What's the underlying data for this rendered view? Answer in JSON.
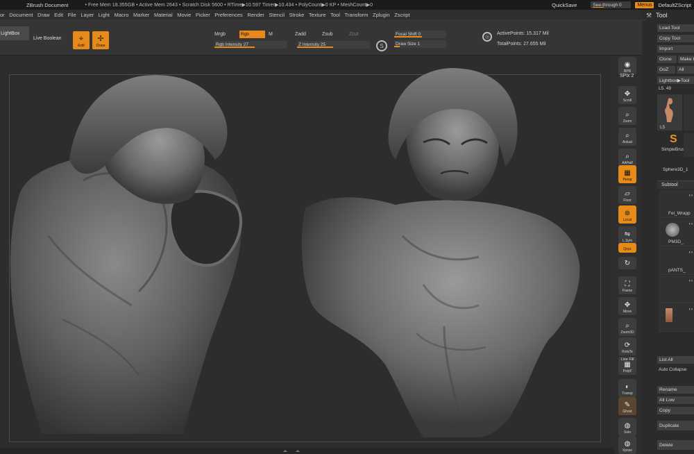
{
  "titlebar": {
    "doc": "ZBrush Document",
    "stats": "• Free Mem 18.355GB • Active Mem 2643 • Scratch Disk 5600 • RTime▶10.597 Timer▶10.434 • PolyCount▶0 KP • MeshCount▶0",
    "quicksave": "QuickSave",
    "seethrough": "See-through  0",
    "menus": "Menus",
    "default_script": "DefaultZScript"
  },
  "menubar": {
    "items": [
      "or",
      "Document",
      "Draw",
      "Edit",
      "File",
      "Layer",
      "Light",
      "Macro",
      "Marker",
      "Material",
      "Movie",
      "Picker",
      "Preferences",
      "Render",
      "Stencil",
      "Stroke",
      "Texture",
      "Tool",
      "Transform",
      "Zplugin",
      "Zscript"
    ]
  },
  "shelf": {
    "lightbox": "LightBox",
    "live_boolean": "Live Boolean",
    "edit": "Edit",
    "draw": "Draw",
    "mrgb": "Mrgb",
    "rgb": "Rgb",
    "m": "M",
    "zadd": "Zadd",
    "zsub": "Zsub",
    "zcut": "Zcut",
    "rgb_intensity": "Rgb Intensity 27",
    "z_intensity": "Z Intensity 25",
    "focal_shift": "Focal Shift 0",
    "draw_size": "Draw Size 1",
    "active_points": "ActivePoints: 15.317 Mil",
    "total_points": "TotalPoints: 27.655 Mil"
  },
  "toolpanel": {
    "title": "Tool",
    "load_tool": "Load Tool",
    "copy_tool": "Copy Tool",
    "import": "Import",
    "clone": "Clone",
    "make": "Make I",
    "goz": "GoZ",
    "all": "All",
    "lightbox_tools": "Lightbox▶Tool",
    "ls": "L5. 49",
    "thumb_label": "L5",
    "simplebrush": "SimpleBrush",
    "sphere": "Sphere3D_1",
    "subtool": "Subtool",
    "subtools": [
      {
        "name": "Fei_Wrapp"
      },
      {
        "name": "PM3D_"
      },
      {
        "name": "pANTS_"
      },
      {
        "name": ""
      },
      {
        "name": ""
      }
    ],
    "list_all": "List All",
    "auto_collapse": "Auto Collapse",
    "rename": "Rename",
    "all_low": "All Low",
    "copy": "Copy",
    "duplicate": "Duplicate",
    "delete": "Delete"
  },
  "iconcol": {
    "bpr": "BPR",
    "spix": "SPix 2",
    "scroll": "Scroll",
    "zoom": "Zoom",
    "actual": "Actual",
    "aahalf": "AAHalf",
    "persp": "Persp",
    "floor": "Floor",
    "local": "Local",
    "lsym": "L.Sym",
    "xyz": "Qxyz",
    "frame": "Frame",
    "move": "Move",
    "zoom3d": "Zoom3D",
    "rotate": "RotaTe",
    "linefill": "Line Fill",
    "polyf": "PolyF",
    "transp": "Transp",
    "ghost": "Ghost",
    "solo": "Solo",
    "xpose": "Xpose"
  }
}
